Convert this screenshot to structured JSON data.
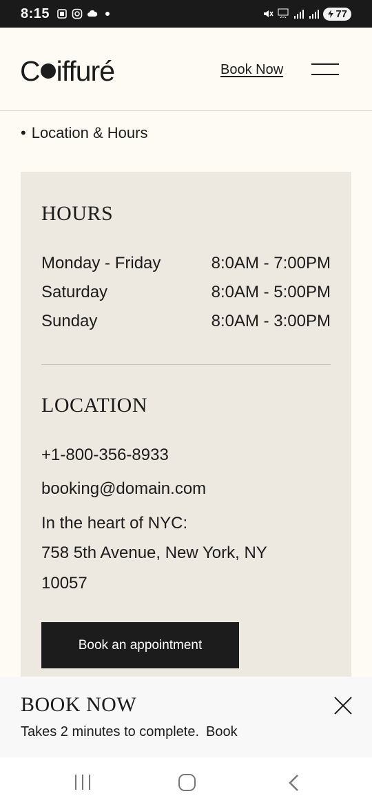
{
  "status_bar": {
    "time": "8:15",
    "battery": "77"
  },
  "header": {
    "logo_prefix": "C",
    "logo_suffix": "iffuré",
    "book_now_label": "Book Now"
  },
  "breadcrumb": {
    "bullet": "•",
    "label": "Location & Hours"
  },
  "hours": {
    "title": "HOURS",
    "rows": [
      {
        "day": "Monday - Friday",
        "time": "8:0AM - 7:00PM"
      },
      {
        "day": "Saturday",
        "time": "8:0AM - 5:00PM"
      },
      {
        "day": "Sunday",
        "time": "8:0AM - 3:00PM"
      }
    ]
  },
  "location": {
    "title": "LOCATION",
    "phone": "+1-800-356-8933",
    "email": "booking@domain.com",
    "address_intro": "In the heart of NYC:",
    "address_line1": "758 5th Avenue, New York, NY",
    "address_line2": "10057",
    "button_label": "Book an appointment"
  },
  "banner": {
    "title": "BOOK NOW",
    "text": "Takes 2 minutes to complete.",
    "link": "Book"
  }
}
